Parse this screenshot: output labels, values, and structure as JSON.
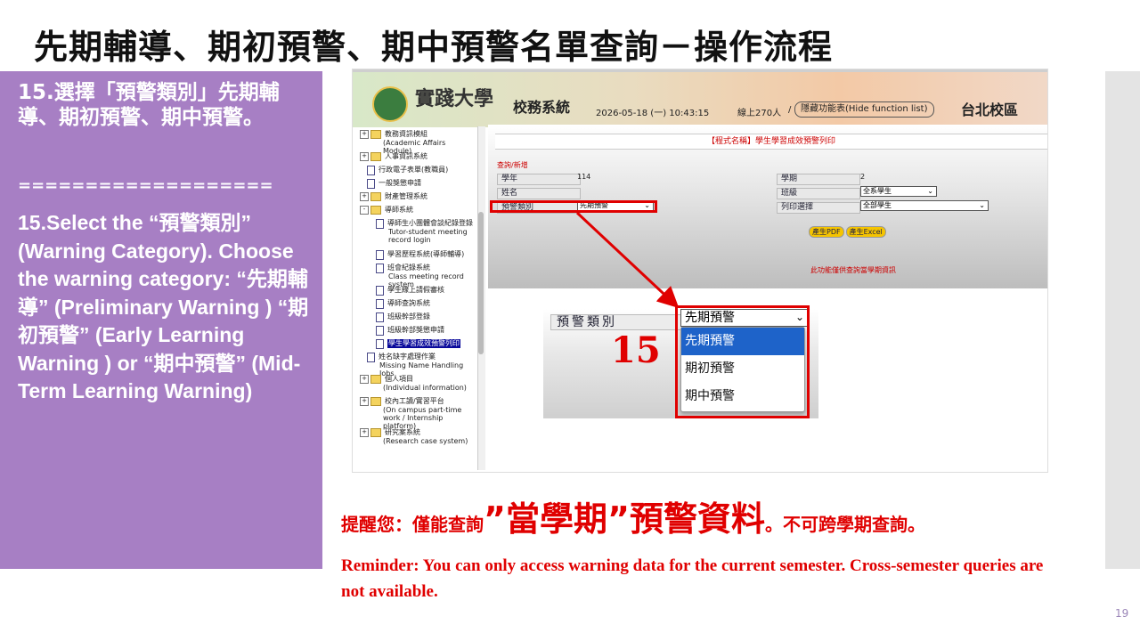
{
  "slide": {
    "title": "先期輔導、期初預警、期中預警名單查詢－操作流程",
    "page_number": "19"
  },
  "left_panel": {
    "zh_text": "15.選擇「預警類別」先期輔導、期初預警、期中預警。",
    "separator": "===================",
    "en_text": "15.Select the “預警類別” (Warning Category). Choose the warning category: “先期輔導” (Preliminary Warning ) “期初預警” (Early Learning Warning ) or “期中預警” (Mid-Term Learning Warning)"
  },
  "header": {
    "university": "實踐大學",
    "system": "校務系統",
    "datetime": "2026-05-18 (一) 10:43:15",
    "online": "線上270人",
    "separator": "/",
    "hide_menu": "隱藏功能表(Hide function list)",
    "campus": "台北校區"
  },
  "tree": [
    {
      "type": "folder",
      "expand": "+",
      "label": "教務資訊模組",
      "sub": "(Academic Affairs Module)"
    },
    {
      "type": "folder",
      "expand": "+",
      "label": "人事資訊系統",
      "sub": ""
    },
    {
      "type": "doc",
      "label": "行政電子表單(教職員)",
      "sub": ""
    },
    {
      "type": "doc",
      "label": "一般獎懲申請",
      "sub": ""
    },
    {
      "type": "folder",
      "expand": "+",
      "label": "財產管理系統",
      "sub": ""
    },
    {
      "type": "folder",
      "expand": "-",
      "label": "導師系統",
      "sub": ""
    },
    {
      "type": "doc",
      "label": "導師生小團體會談紀錄登錄",
      "sub": "Tutor-student meeting record login"
    },
    {
      "type": "doc",
      "label": "學習歷程系統(導師輔導)",
      "sub": ""
    },
    {
      "type": "doc",
      "label": "班會紀錄系統",
      "sub": "Class meeting record system"
    },
    {
      "type": "doc",
      "label": "學生線上請假審核",
      "sub": ""
    },
    {
      "type": "doc",
      "label": "導師查詢系統",
      "sub": ""
    },
    {
      "type": "doc",
      "label": "班級幹部登錄",
      "sub": ""
    },
    {
      "type": "doc",
      "label": "班級幹部獎懲申請",
      "sub": ""
    },
    {
      "type": "doc",
      "label": "學生學習成效預警列印",
      "sub": "",
      "selected": true
    },
    {
      "type": "doc",
      "label": "姓名缺字處理作業",
      "sub": "Missing Name Handling Jobs"
    },
    {
      "type": "folder",
      "expand": "+",
      "label": "個人項目",
      "sub": "(Individual information)"
    },
    {
      "type": "folder",
      "expand": "+",
      "label": "校內工讀/實習平台",
      "sub": "(On campus part-time work / Internship platform)"
    },
    {
      "type": "folder",
      "expand": "+",
      "label": "研究案系統",
      "sub": "(Research case system)"
    }
  ],
  "form": {
    "program_title": "【程式名稱】學生學習成效預警列印",
    "query_title": "查詢/新增",
    "year_label": "學年",
    "year_value": "114",
    "term_label": "學期",
    "term_value": "2",
    "name_label": "姓名",
    "class_label": "班級",
    "class_value": "全系學生",
    "category_label": "預警類別",
    "category_value": "先期預警",
    "print_label": "列印選擇",
    "print_value": "全部學生",
    "pdf_button": "產生PDF",
    "excel_button": "產生Excel",
    "notice": "此功能僅供查詢當學期資訊"
  },
  "zoom": {
    "label": "預警類別",
    "selected": "先期預警",
    "options": [
      "先期預警",
      "期初預警",
      "期中預警"
    ],
    "step": "15"
  },
  "reminder": {
    "zh_prefix": "提醒您：僅能查詢",
    "zh_big": "”當學期”預警資料",
    "zh_suffix": "。不可跨學期查詢。",
    "en": "Reminder: You can only access warning data for the current semester. Cross-semester queries are not available."
  },
  "colors": {
    "panel": "#a77fc4",
    "alert_red": "#e00000",
    "highlight_blue": "#1e63c9"
  }
}
